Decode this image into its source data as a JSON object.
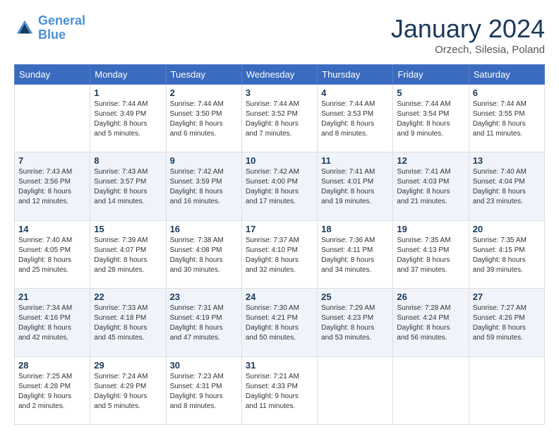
{
  "header": {
    "logo_line1": "General",
    "logo_line2": "Blue",
    "month_title": "January 2024",
    "subtitle": "Orzech, Silesia, Poland"
  },
  "days_of_week": [
    "Sunday",
    "Monday",
    "Tuesday",
    "Wednesday",
    "Thursday",
    "Friday",
    "Saturday"
  ],
  "weeks": [
    [
      {
        "day": "",
        "info": ""
      },
      {
        "day": "1",
        "info": "Sunrise: 7:44 AM\nSunset: 3:49 PM\nDaylight: 8 hours\nand 5 minutes."
      },
      {
        "day": "2",
        "info": "Sunrise: 7:44 AM\nSunset: 3:50 PM\nDaylight: 8 hours\nand 6 minutes."
      },
      {
        "day": "3",
        "info": "Sunrise: 7:44 AM\nSunset: 3:52 PM\nDaylight: 8 hours\nand 7 minutes."
      },
      {
        "day": "4",
        "info": "Sunrise: 7:44 AM\nSunset: 3:53 PM\nDaylight: 8 hours\nand 8 minutes."
      },
      {
        "day": "5",
        "info": "Sunrise: 7:44 AM\nSunset: 3:54 PM\nDaylight: 8 hours\nand 9 minutes."
      },
      {
        "day": "6",
        "info": "Sunrise: 7:44 AM\nSunset: 3:55 PM\nDaylight: 8 hours\nand 11 minutes."
      }
    ],
    [
      {
        "day": "7",
        "info": "Sunrise: 7:43 AM\nSunset: 3:56 PM\nDaylight: 8 hours\nand 12 minutes."
      },
      {
        "day": "8",
        "info": "Sunrise: 7:43 AM\nSunset: 3:57 PM\nDaylight: 8 hours\nand 14 minutes."
      },
      {
        "day": "9",
        "info": "Sunrise: 7:42 AM\nSunset: 3:59 PM\nDaylight: 8 hours\nand 16 minutes."
      },
      {
        "day": "10",
        "info": "Sunrise: 7:42 AM\nSunset: 4:00 PM\nDaylight: 8 hours\nand 17 minutes."
      },
      {
        "day": "11",
        "info": "Sunrise: 7:41 AM\nSunset: 4:01 PM\nDaylight: 8 hours\nand 19 minutes."
      },
      {
        "day": "12",
        "info": "Sunrise: 7:41 AM\nSunset: 4:03 PM\nDaylight: 8 hours\nand 21 minutes."
      },
      {
        "day": "13",
        "info": "Sunrise: 7:40 AM\nSunset: 4:04 PM\nDaylight: 8 hours\nand 23 minutes."
      }
    ],
    [
      {
        "day": "14",
        "info": "Sunrise: 7:40 AM\nSunset: 4:05 PM\nDaylight: 8 hours\nand 25 minutes."
      },
      {
        "day": "15",
        "info": "Sunrise: 7:39 AM\nSunset: 4:07 PM\nDaylight: 8 hours\nand 28 minutes."
      },
      {
        "day": "16",
        "info": "Sunrise: 7:38 AM\nSunset: 4:08 PM\nDaylight: 8 hours\nand 30 minutes."
      },
      {
        "day": "17",
        "info": "Sunrise: 7:37 AM\nSunset: 4:10 PM\nDaylight: 8 hours\nand 32 minutes."
      },
      {
        "day": "18",
        "info": "Sunrise: 7:36 AM\nSunset: 4:11 PM\nDaylight: 8 hours\nand 34 minutes."
      },
      {
        "day": "19",
        "info": "Sunrise: 7:35 AM\nSunset: 4:13 PM\nDaylight: 8 hours\nand 37 minutes."
      },
      {
        "day": "20",
        "info": "Sunrise: 7:35 AM\nSunset: 4:15 PM\nDaylight: 8 hours\nand 39 minutes."
      }
    ],
    [
      {
        "day": "21",
        "info": "Sunrise: 7:34 AM\nSunset: 4:16 PM\nDaylight: 8 hours\nand 42 minutes."
      },
      {
        "day": "22",
        "info": "Sunrise: 7:33 AM\nSunset: 4:18 PM\nDaylight: 8 hours\nand 45 minutes."
      },
      {
        "day": "23",
        "info": "Sunrise: 7:31 AM\nSunset: 4:19 PM\nDaylight: 8 hours\nand 47 minutes."
      },
      {
        "day": "24",
        "info": "Sunrise: 7:30 AM\nSunset: 4:21 PM\nDaylight: 8 hours\nand 50 minutes."
      },
      {
        "day": "25",
        "info": "Sunrise: 7:29 AM\nSunset: 4:23 PM\nDaylight: 8 hours\nand 53 minutes."
      },
      {
        "day": "26",
        "info": "Sunrise: 7:28 AM\nSunset: 4:24 PM\nDaylight: 8 hours\nand 56 minutes."
      },
      {
        "day": "27",
        "info": "Sunrise: 7:27 AM\nSunset: 4:26 PM\nDaylight: 8 hours\nand 59 minutes."
      }
    ],
    [
      {
        "day": "28",
        "info": "Sunrise: 7:25 AM\nSunset: 4:28 PM\nDaylight: 9 hours\nand 2 minutes."
      },
      {
        "day": "29",
        "info": "Sunrise: 7:24 AM\nSunset: 4:29 PM\nDaylight: 9 hours\nand 5 minutes."
      },
      {
        "day": "30",
        "info": "Sunrise: 7:23 AM\nSunset: 4:31 PM\nDaylight: 9 hours\nand 8 minutes."
      },
      {
        "day": "31",
        "info": "Sunrise: 7:21 AM\nSunset: 4:33 PM\nDaylight: 9 hours\nand 11 minutes."
      },
      {
        "day": "",
        "info": ""
      },
      {
        "day": "",
        "info": ""
      },
      {
        "day": "",
        "info": ""
      }
    ]
  ]
}
